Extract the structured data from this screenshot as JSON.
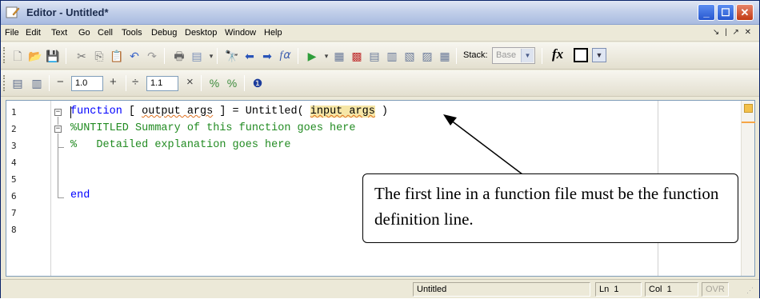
{
  "window": {
    "title": "Editor - Untitled*"
  },
  "menu": [
    "File",
    "Edit",
    "Text",
    "Go",
    "Cell",
    "Tools",
    "Debug",
    "Desktop",
    "Window",
    "Help"
  ],
  "toolbar": {
    "stack_label": "Stack:",
    "stack_value": "Base",
    "fx_label": "fx"
  },
  "cell_toolbar": {
    "minus": "−",
    "value1": "1.0",
    "plus": "+",
    "divide": "÷",
    "value2": "1.1",
    "times": "×"
  },
  "editor": {
    "line_numbers": [
      "1",
      "2",
      "3",
      "4",
      "5",
      "6",
      "7",
      "8"
    ],
    "lines": {
      "l1_kw": "function",
      "l1_a": " [ ",
      "l1_out": "output args",
      "l1_b": " ] = Untitled( ",
      "l1_in": "input args",
      "l1_c": " )",
      "l2": "%UNTITLED Summary of this function goes here",
      "l3": "%   Detailed explanation goes here",
      "l6": "end"
    }
  },
  "callout": {
    "text": "The first line in a function file must be the function definition line."
  },
  "status": {
    "file": "Untitled",
    "ln_label": "Ln",
    "ln": "1",
    "col_label": "Col",
    "col": "1",
    "mode": "OVR"
  }
}
